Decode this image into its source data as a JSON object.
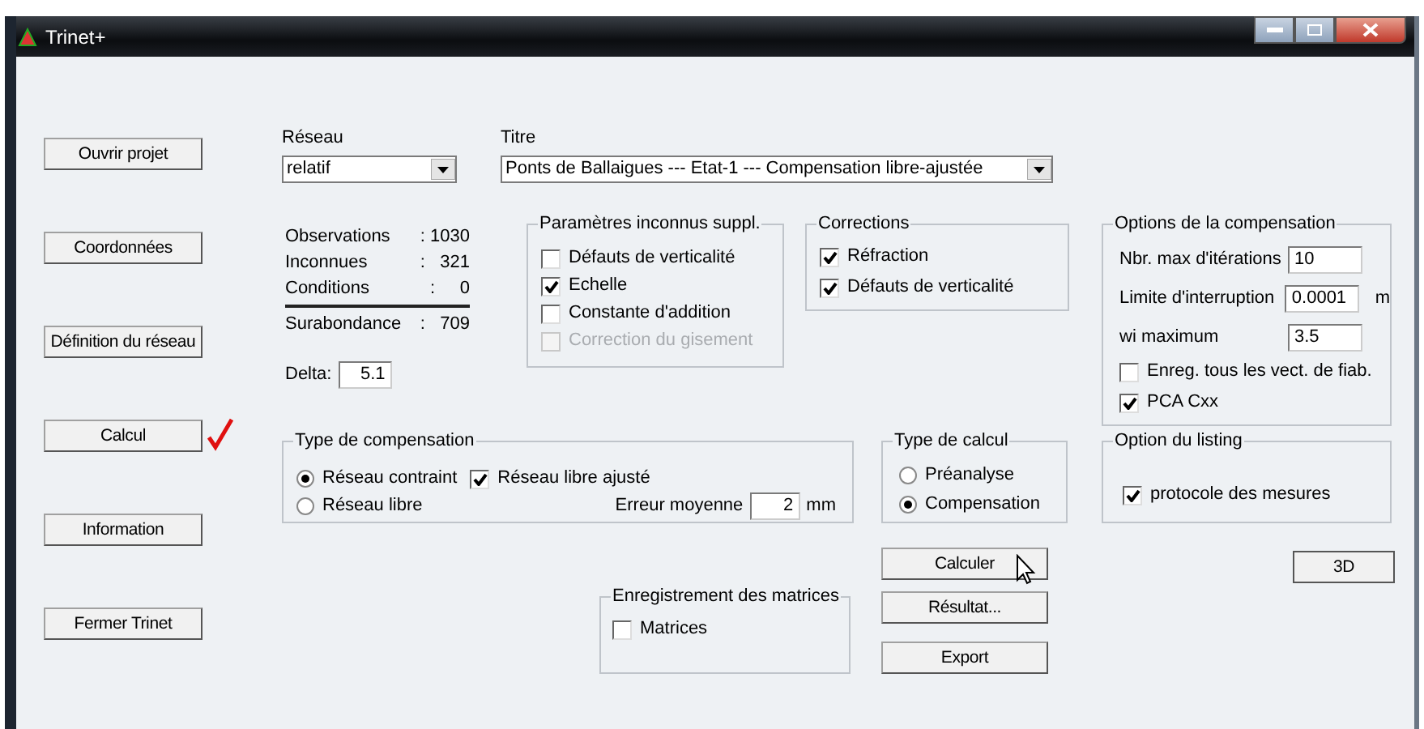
{
  "window": {
    "title": "Trinet+"
  },
  "side_buttons": [
    {
      "label": "Ouvrir projet",
      "checked": false
    },
    {
      "label": "Coordonnées",
      "checked": false
    },
    {
      "label": "Définition du réseau",
      "checked": false
    },
    {
      "label": "Calcul",
      "checked": true
    },
    {
      "label": "Information",
      "checked": false
    },
    {
      "label": "Fermer Trinet",
      "checked": false
    }
  ],
  "network": {
    "label": "Réseau",
    "value": "relatif"
  },
  "title": {
    "label": "Titre",
    "value": "Ponts de Ballaigues --- Etat-1 --- Compensation libre-ajustée"
  },
  "statistics": {
    "rows": [
      {
        "label": "Observations",
        "value": ": 1030"
      },
      {
        "label": "Inconnues",
        "value": ":   321"
      },
      {
        "label": "Conditions",
        "value": ":     0"
      }
    ],
    "total": {
      "label": "Surabondance",
      "value": ":   709"
    }
  },
  "delta": {
    "label": "Delta:",
    "value": "5.1"
  },
  "unknown_parameters": {
    "title": "Paramètres inconnus suppl.",
    "options": [
      {
        "label": "Défauts de verticalité",
        "checked": false,
        "disabled": false
      },
      {
        "label": "Echelle",
        "checked": true,
        "disabled": false
      },
      {
        "label": "Constante d'addition",
        "checked": false,
        "disabled": false
      },
      {
        "label": "Correction du gisement",
        "checked": false,
        "disabled": true
      }
    ]
  },
  "corrections": {
    "title": "Corrections",
    "options": [
      {
        "label": "Réfraction",
        "checked": true,
        "disabled": false
      },
      {
        "label": "Défauts de verticalité",
        "checked": true,
        "disabled": false
      }
    ]
  },
  "compensation_options": {
    "title": "Options de la compensation",
    "fields": [
      {
        "label": "Nbr. max d'itérations",
        "value": "10"
      },
      {
        "label": "Limite d'interruption",
        "value": "0.0001",
        "unit": "m"
      },
      {
        "label": "wi maximum",
        "value": "3.5"
      }
    ],
    "options": [
      {
        "label": "Enreg. tous les vect. de fiab.",
        "checked": false,
        "disabled": false
      },
      {
        "label": "PCA Cxx",
        "checked": true,
        "disabled": false
      }
    ]
  },
  "compensation_type": {
    "title": "Type de compensation",
    "radios": [
      {
        "label": "Réseau contraint",
        "selected": true
      },
      {
        "label": "Réseau libre",
        "selected": false
      }
    ],
    "adjusted_free": {
      "label": "Réseau libre ajusté",
      "checked": true,
      "disabled": false
    },
    "mean_error": {
      "label": "Erreur moyenne",
      "value": "2",
      "unit": "mm"
    }
  },
  "calculation_type": {
    "title": "Type de calcul",
    "radios": [
      {
        "label": "Préanalyse",
        "selected": false
      },
      {
        "label": "Compensation",
        "selected": true
      }
    ]
  },
  "listing_option": {
    "title": "Option du listing",
    "options": [
      {
        "label": "protocole des mesures",
        "checked": true,
        "disabled": false
      }
    ]
  },
  "matrix_saving": {
    "title": "Enregistrement des matrices",
    "options": [
      {
        "label": "Matrices",
        "checked": false,
        "disabled": false
      }
    ]
  },
  "action_buttons": [
    {
      "label": "Calculer"
    },
    {
      "label": "Résultat..."
    },
    {
      "label": "Export"
    }
  ],
  "button_3d": {
    "label": "3D"
  }
}
